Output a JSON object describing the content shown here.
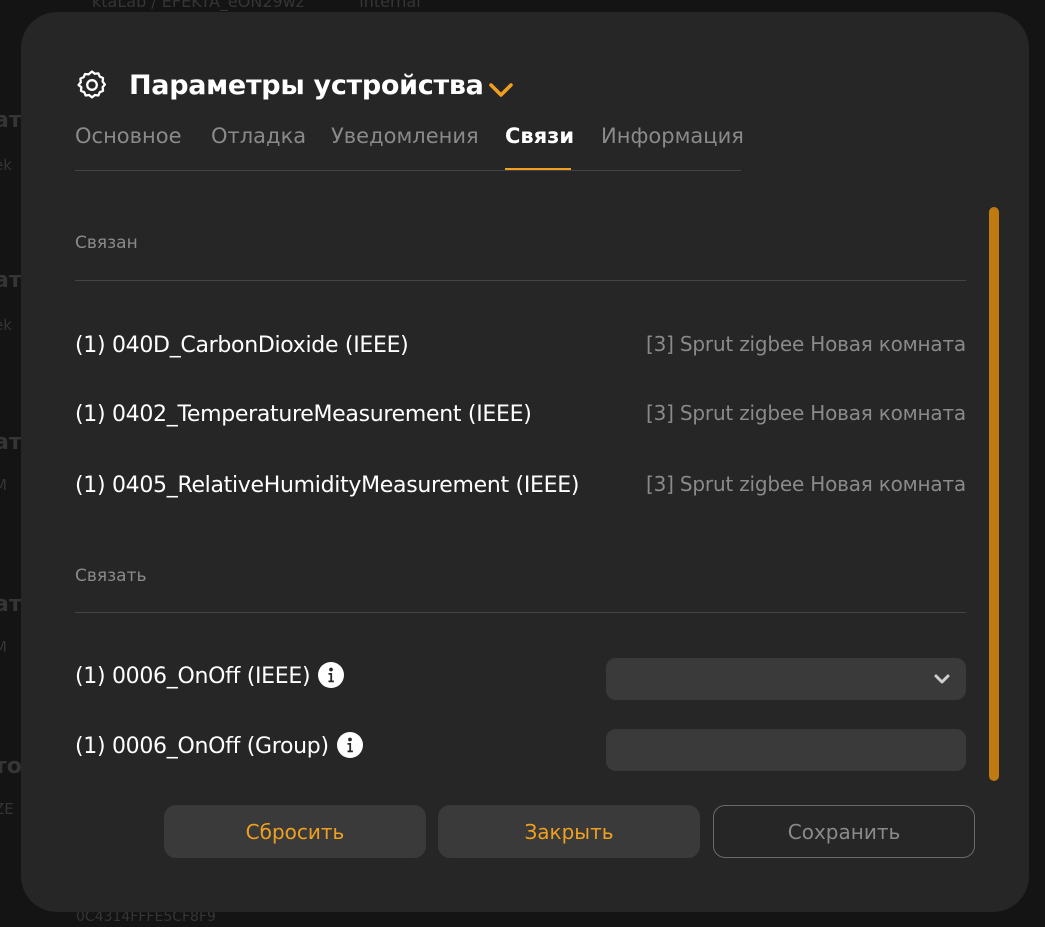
{
  "background": {
    "breadcrumb": "ktaLab / EFEKTA_eON29wz",
    "breadcrumb_badge": "internal",
    "items": [
      {
        "head": "ат",
        "sub": "ek"
      },
      {
        "head": "ат",
        "sub": "ek"
      },
      {
        "head": "ат",
        "sub": "M"
      },
      {
        "head": "ат",
        "sub": "M"
      },
      {
        "head": "то",
        "sub": "ZE"
      }
    ],
    "footer_text": "0C4314FFFE5CF8F9"
  },
  "modal": {
    "title": "Параметры устройства",
    "tabs": [
      {
        "label": "Основное",
        "active": false
      },
      {
        "label": "Отладка",
        "active": false
      },
      {
        "label": "Уведомления",
        "active": false
      },
      {
        "label": "Связи",
        "active": true
      },
      {
        "label": "Информация",
        "active": false
      }
    ],
    "bound_section": {
      "label": "Связан",
      "rows": [
        {
          "name": "(1) 040D_CarbonDioxide (IEEE)",
          "target": "[3] Sprut zigbee Новая комната"
        },
        {
          "name": "(1) 0402_TemperatureMeasurement (IEEE)",
          "target": "[3] Sprut zigbee Новая комната"
        },
        {
          "name": "(1) 0405_RelativeHumidityMeasurement (IEEE)",
          "target": "[3] Sprut zigbee Новая комната"
        }
      ]
    },
    "bind_section": {
      "label": "Связать",
      "rows": [
        {
          "name": "(1) 0006_OnOff (IEEE)",
          "control": "select",
          "value": ""
        },
        {
          "name": "(1) 0006_OnOff (Group)",
          "control": "input",
          "value": ""
        }
      ]
    },
    "buttons": {
      "reset": "Сбросить",
      "close": "Закрыть",
      "save": "Сохранить"
    }
  },
  "colors": {
    "accent": "#f0a020",
    "modal_bg": "#262626",
    "control_bg": "#3a3a3a",
    "muted_text": "#8a8a8a"
  },
  "icons": {
    "settings": "gear-icon",
    "title_dropdown": "chevron-down-icon",
    "info": "info-icon",
    "select_dropdown": "chevron-down-icon"
  }
}
